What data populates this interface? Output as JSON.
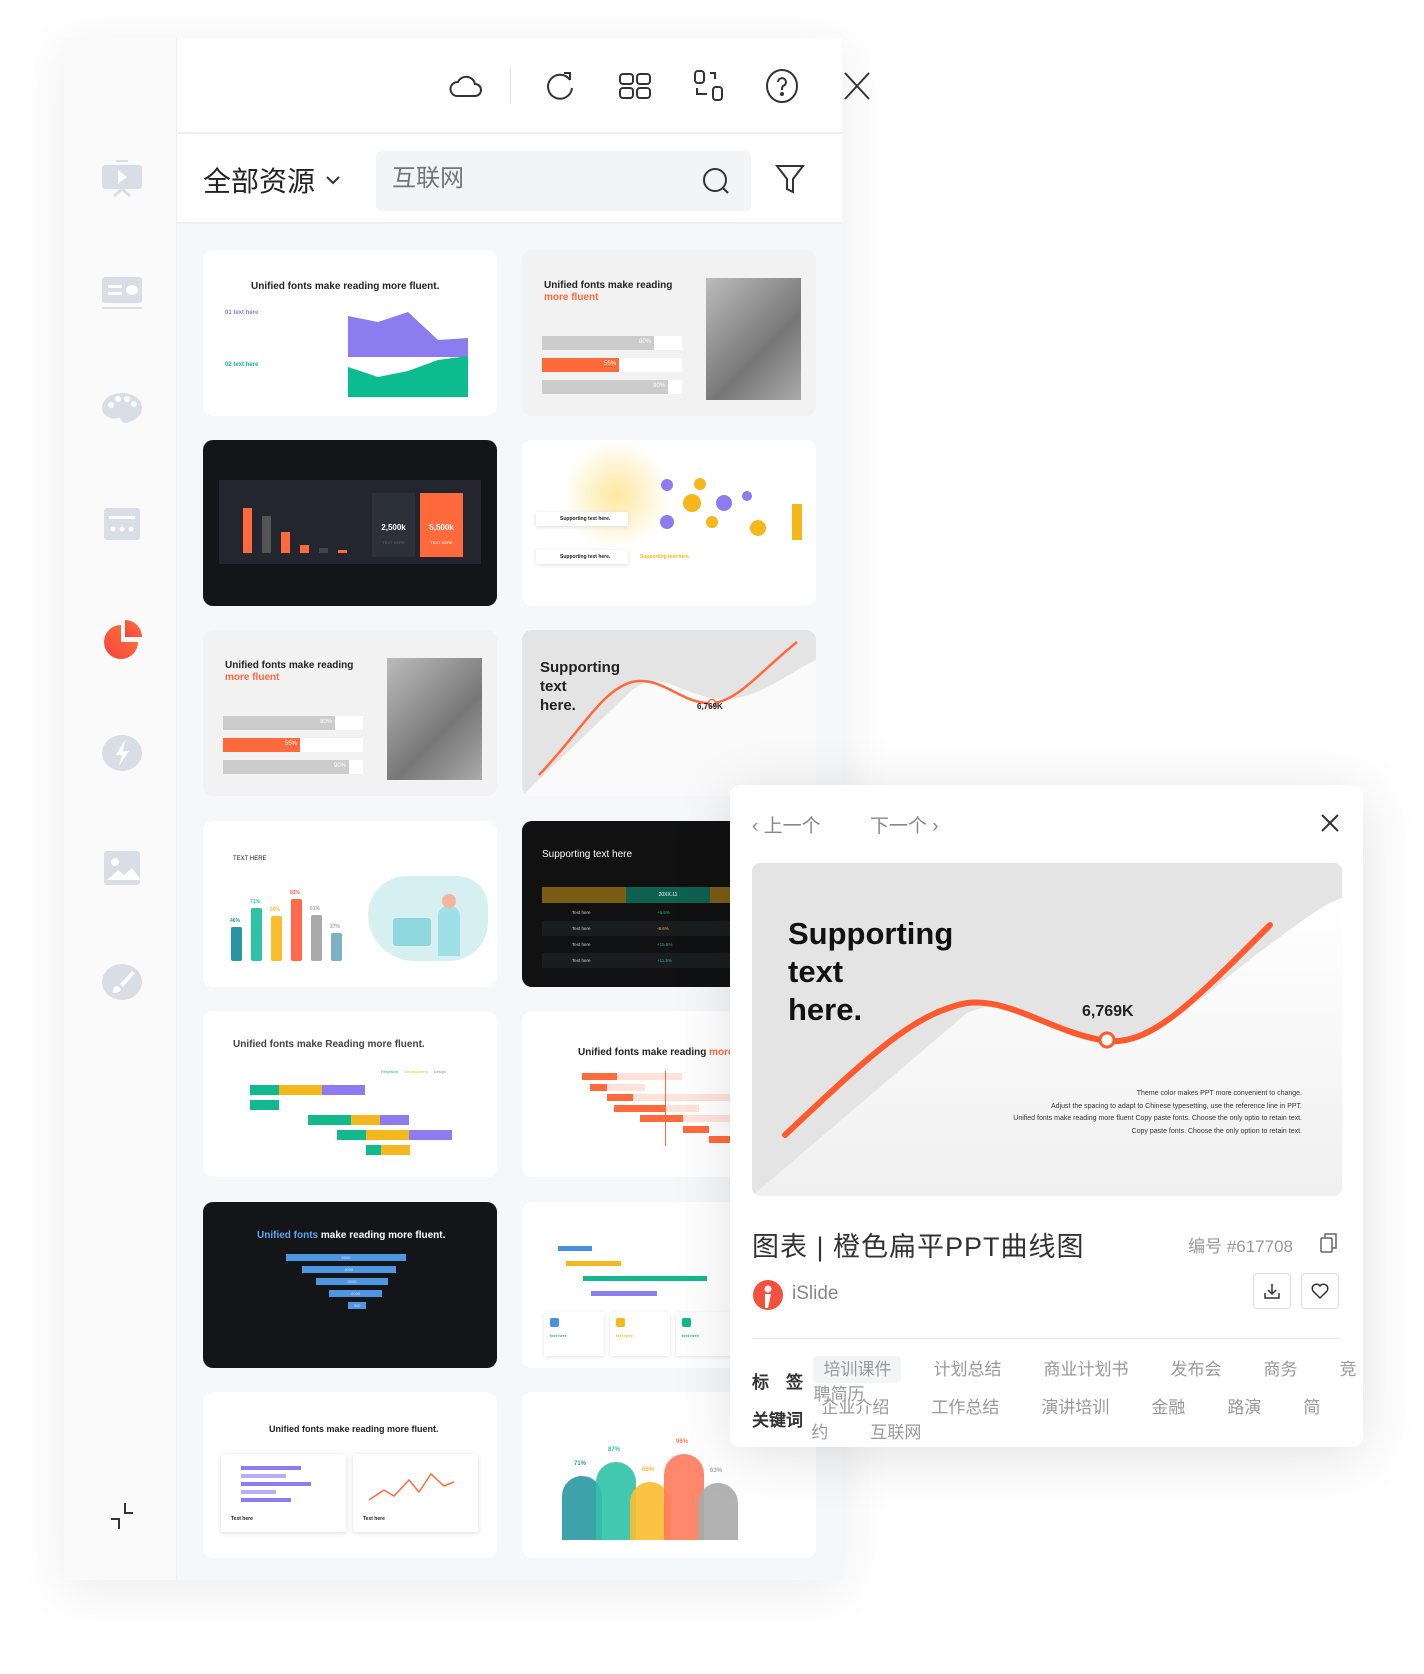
{
  "toolbar": {
    "icons": [
      "cloud-icon",
      "refresh-icon",
      "grid-icon",
      "switch-layout-icon",
      "help-icon",
      "close-icon"
    ]
  },
  "sidebar": {
    "items": [
      "presentation",
      "text-card",
      "palette",
      "layout",
      "chart",
      "lightning",
      "image",
      "brush"
    ],
    "active": "chart",
    "active_color": "#f5503c",
    "collapse": "collapse-icon"
  },
  "search": {
    "scope": "全部资源",
    "placeholder": "互联网"
  },
  "cards": [
    {
      "title": "Unified fonts make reading more fluent.",
      "items": [
        "01  text here",
        "02  text here"
      ]
    },
    {
      "title": "Unified fonts make reading",
      "accent": "more fluent",
      "bars": [
        "80%",
        "55%",
        "90%"
      ]
    },
    {
      "stats": [
        "2,500k",
        "5,500k"
      ],
      "labels": [
        "TEXT HERE",
        "TEXT HERE"
      ]
    },
    {
      "items": [
        "Supporting text here.",
        "Supporting text here."
      ],
      "caption": "Supporting text here."
    },
    {
      "title": "Unified fonts make reading",
      "accent": "more fluent",
      "bars": [
        "80%",
        "55%",
        "90%"
      ]
    },
    {
      "heading": [
        "Supporting",
        "text",
        "here."
      ],
      "value": "6,769K"
    },
    {
      "title": "TEXT HERE",
      "bars": [
        "46%",
        "71%",
        "60%",
        "83%",
        "61%",
        "37%"
      ]
    },
    {
      "title": "Supporting text here",
      "header": "20XX.11",
      "rows": [
        "Text here",
        "Text here",
        "Text here",
        "Text here"
      ],
      "values": [
        "+6.5%",
        "-8.6%",
        "+15.5%",
        "+11.5%"
      ]
    },
    {
      "title": "Unified fonts make Reading more fluent.",
      "legend": [
        "Research",
        "Development",
        "Design"
      ]
    },
    {
      "title": "Unified fonts make reading",
      "accent": "more"
    },
    {
      "accent": "Unified fonts",
      "title": " make reading more fluent.",
      "values": [
        "5000",
        "4000",
        "3000",
        "2000",
        "500"
      ]
    },
    {
      "items": [
        "text here",
        "text here",
        "text here"
      ]
    },
    {
      "title": "Unified fonts make reading more fluent.",
      "items": [
        "Text here",
        "Text here"
      ]
    },
    {
      "values": [
        "71%",
        "87%",
        "65%",
        "96%",
        "63%"
      ]
    }
  ],
  "popup": {
    "prev": "‹ 上一个",
    "next": "下一个 ›",
    "preview": {
      "heading": [
        "Supporting",
        "text",
        "here."
      ],
      "value": "6,769K",
      "body": [
        "Theme color makes PPT more convenient to change.",
        "Adjust the spacing to adapt to Chinese typesetting, use the reference line in PPT.",
        "Unified fonts make reading more fluent Copy paste fonts. Choose the only optio to retain text.",
        "Copy paste  fonts. Choose the only option to retain text."
      ]
    },
    "title": "图表 | 橙色扁平PPT曲线图",
    "id": "编号 #617708",
    "author": "iSlide",
    "tags_label": "标　签",
    "tags": [
      "培训课件",
      "计划总结",
      "商业计划书",
      "发布会",
      "商务",
      "竞聘简历"
    ],
    "keywords_label": "关键词",
    "keywords": [
      "企业介绍",
      "工作总结",
      "演讲培训",
      "金融",
      "路演",
      "简约",
      "互联网"
    ],
    "accent": "#ff6a3d"
  }
}
